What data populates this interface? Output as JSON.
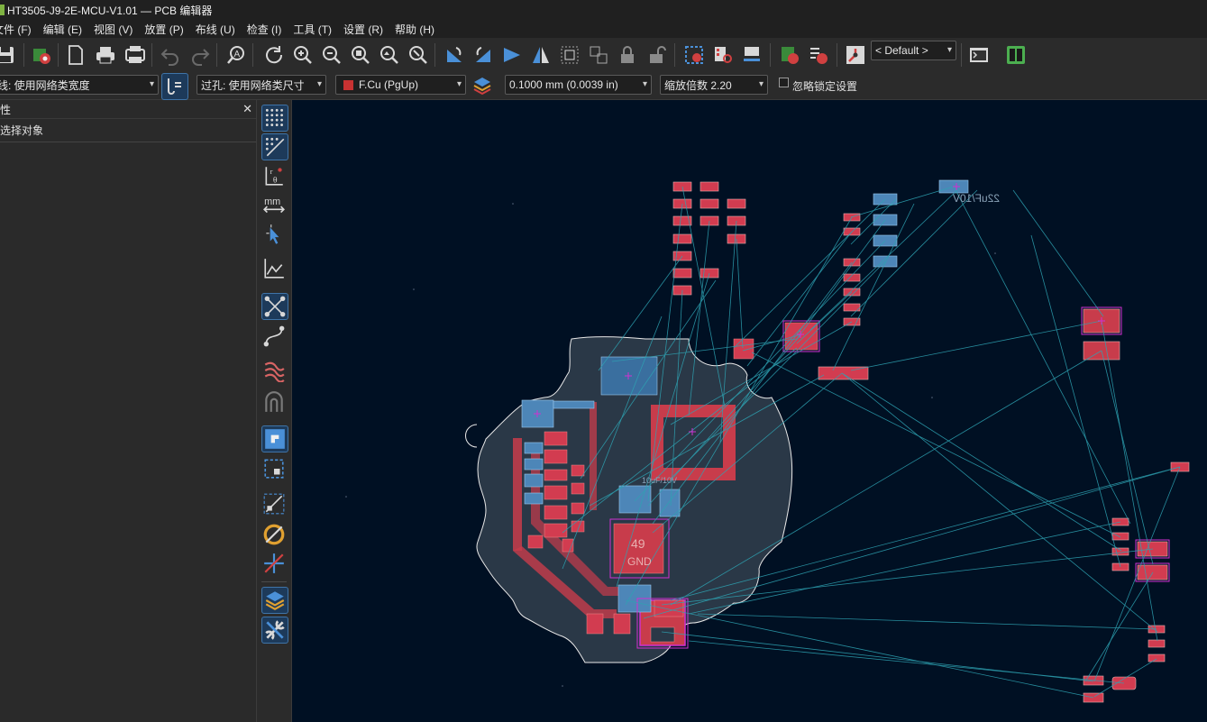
{
  "window": {
    "title": "HT3505-J9-2E-MCU-V1.01 — PCB 编辑器"
  },
  "menu": [
    "文件 (F)",
    "编辑 (E)",
    "视图 (V)",
    "放置 (P)",
    "布线 (U)",
    "检查 (I)",
    "工具 (T)",
    "设置 (R)",
    "帮助 (H)"
  ],
  "toolbar1": {
    "preset_value": "< Default >"
  },
  "toolbar2": {
    "track_width": "线: 使用网络类宽度",
    "via_size": "过孔: 使用网络类尺寸",
    "layer": "F.Cu (PgUp)",
    "layer_color": "#c83232",
    "grid": "0.1000 mm (0.0039 in)",
    "zoom": "缩放倍数 2.20",
    "ignore_locked_label": "忽略锁定设置"
  },
  "properties_panel": {
    "title": "性",
    "close": "✕",
    "empty_text": "选择对象"
  },
  "board": {
    "silk_labels": [
      "22uF/10V",
      "49",
      "GND",
      "10uF/10V"
    ]
  },
  "colors": {
    "canvas_bg": "#001023",
    "board_fill": "#2a3847",
    "fcu": "#c83c4b",
    "bcu": "#4d86b8",
    "ratsnest": "#2ea3b3",
    "courtyard": "#d030d0"
  }
}
